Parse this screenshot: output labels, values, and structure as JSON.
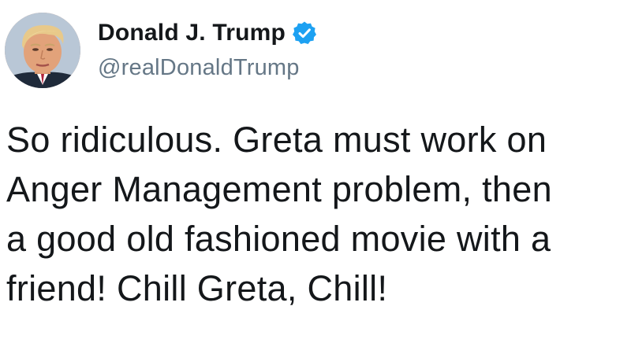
{
  "tweet": {
    "author": {
      "display_name": "Donald J. Trump",
      "handle": "@realDonaldTrump",
      "verified": true,
      "avatar_icon": "profile-photo"
    },
    "text_lines": [
      "So ridiculous. Greta must work on",
      "Anger Management problem, then",
      "a good old fashioned movie with a",
      "friend! Chill Greta, Chill!"
    ]
  },
  "colors": {
    "name": "#14171a",
    "handle": "#657786",
    "verified_blue": "#1da1f2",
    "background": "#ffffff"
  }
}
